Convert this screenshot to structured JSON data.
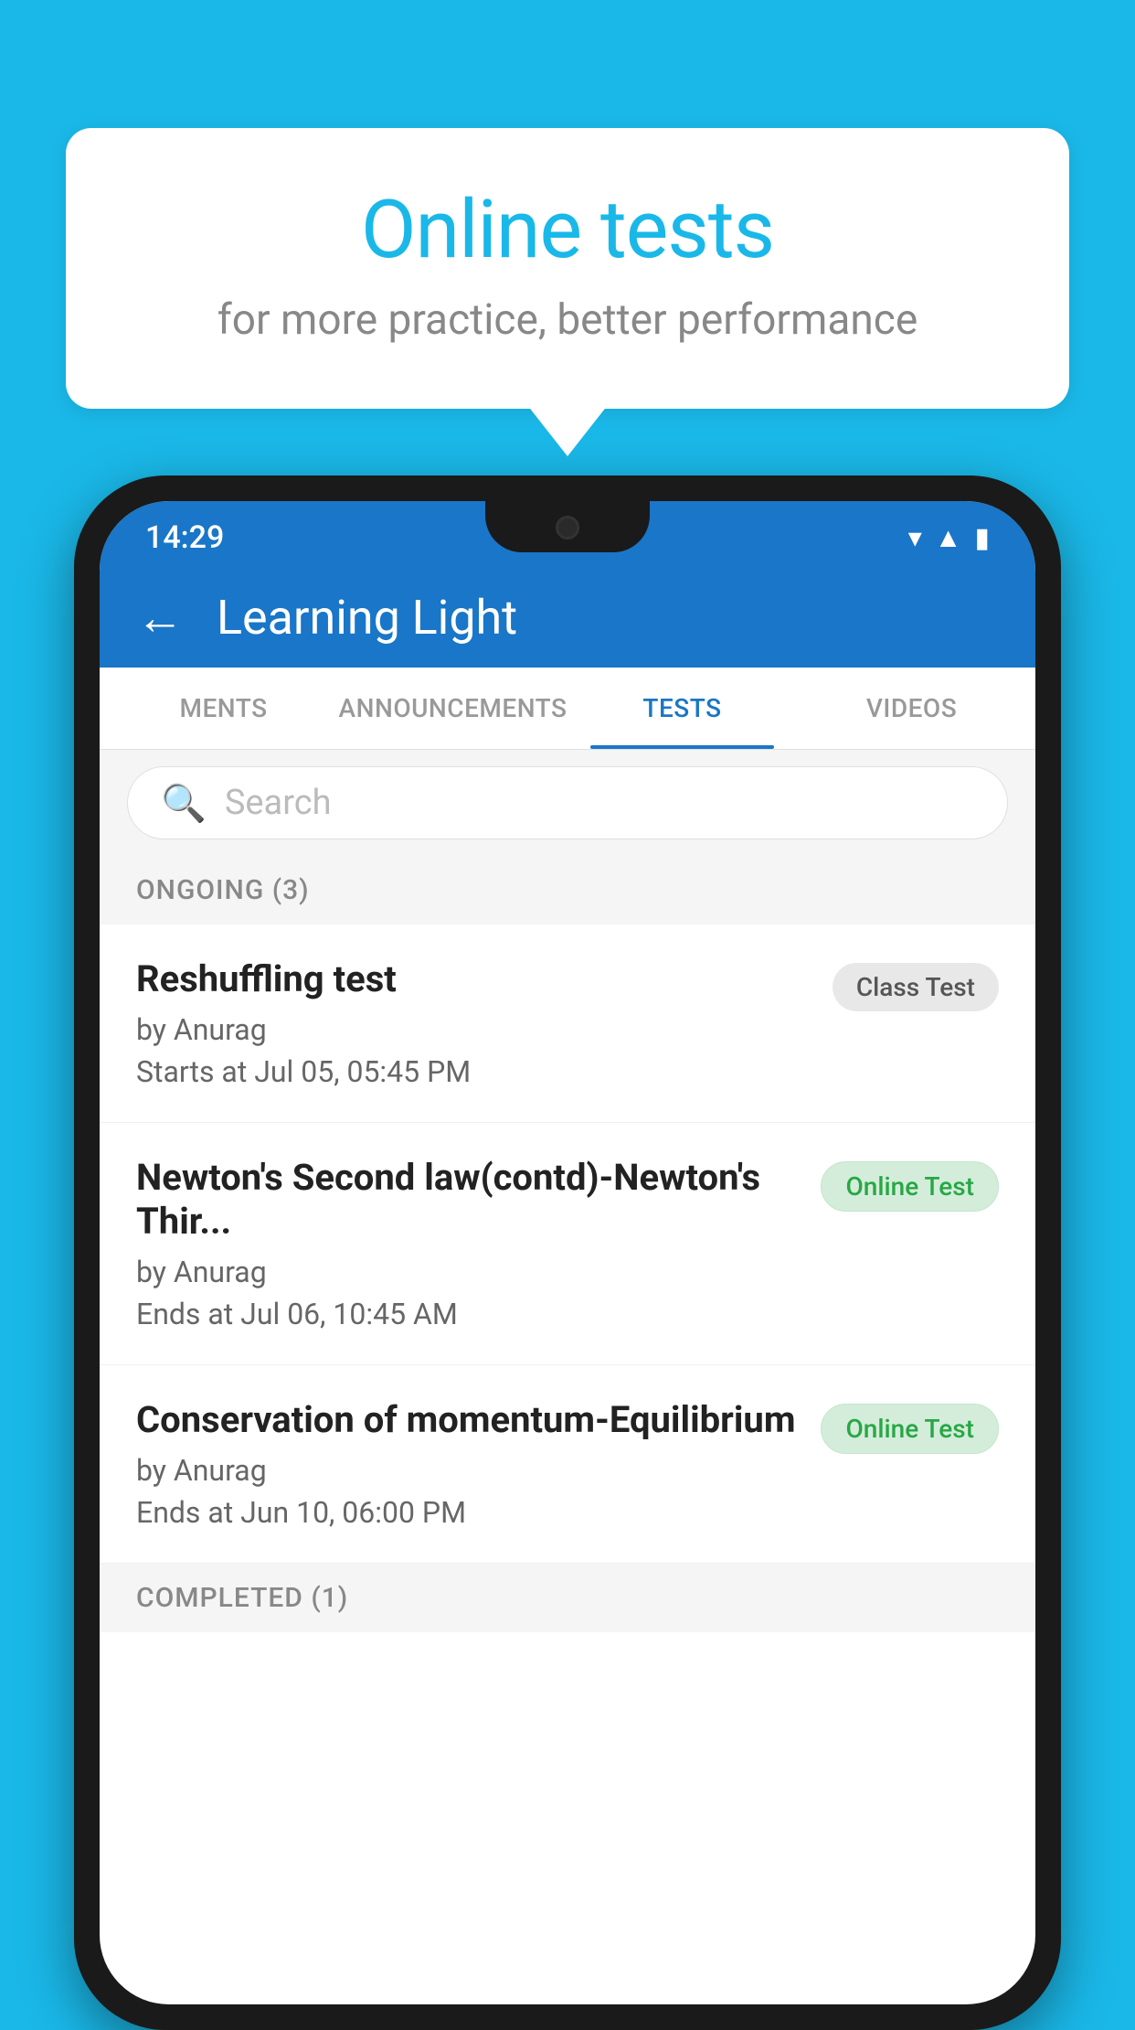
{
  "background_color": "#1ab8e8",
  "speech_bubble": {
    "title": "Online tests",
    "subtitle": "for more practice, better performance"
  },
  "phone": {
    "status_bar": {
      "time": "14:29",
      "icons": [
        "wifi",
        "signal",
        "battery"
      ]
    },
    "app_header": {
      "title": "Learning Light",
      "back_label": "←"
    },
    "tabs": [
      {
        "label": "MENTS",
        "active": false
      },
      {
        "label": "ANNOUNCEMENTS",
        "active": false
      },
      {
        "label": "TESTS",
        "active": true
      },
      {
        "label": "VIDEOS",
        "active": false
      }
    ],
    "search": {
      "placeholder": "Search"
    },
    "ongoing_section": {
      "label": "ONGOING (3)"
    },
    "tests": [
      {
        "name": "Reshuffling test",
        "author": "by Anurag",
        "date": "Starts at  Jul 05, 05:45 PM",
        "badge": "Class Test",
        "badge_type": "class"
      },
      {
        "name": "Newton's Second law(contd)-Newton's Thir...",
        "author": "by Anurag",
        "date": "Ends at  Jul 06, 10:45 AM",
        "badge": "Online Test",
        "badge_type": "online"
      },
      {
        "name": "Conservation of momentum-Equilibrium",
        "author": "by Anurag",
        "date": "Ends at  Jun 10, 06:00 PM",
        "badge": "Online Test",
        "badge_type": "online"
      }
    ],
    "completed_section": {
      "label": "COMPLETED (1)"
    }
  }
}
